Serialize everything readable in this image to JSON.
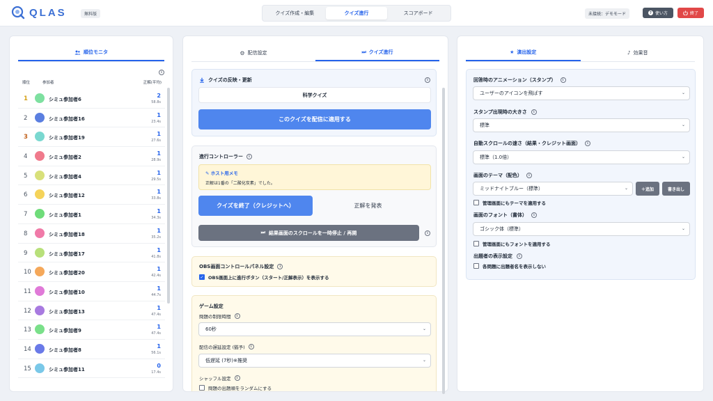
{
  "header": {
    "logo_text": "QLAS",
    "plan_badge": "無料版",
    "tabs": [
      {
        "label": "クイズ作成・編集"
      },
      {
        "label": "クイズ進行"
      },
      {
        "label": "スコアボード"
      }
    ],
    "connection": "未接続：デモモード",
    "help_label": "使い方",
    "end_label": "終了"
  },
  "left": {
    "tab_label": "順位モニタ",
    "col_rank": "順位",
    "col_name": "参加者",
    "col_score": "正解(平均)",
    "rows": [
      {
        "rank": "1",
        "name": "シミュ参加者6",
        "correct": "2",
        "time": "58.8s",
        "color": "#7ee0a0"
      },
      {
        "rank": "2",
        "name": "シミュ参加者16",
        "correct": "1",
        "time": "23.4s",
        "color": "#5b7fe0"
      },
      {
        "rank": "3",
        "name": "シミュ参加者19",
        "correct": "1",
        "time": "27.6s",
        "color": "#7ad8d0"
      },
      {
        "rank": "4",
        "name": "シミュ参加者2",
        "correct": "1",
        "time": "28.9s",
        "color": "#f07a8c"
      },
      {
        "rank": "5",
        "name": "シミュ参加者4",
        "correct": "1",
        "time": "29.5s",
        "color": "#d8e07a"
      },
      {
        "rank": "6",
        "name": "シミュ参加者12",
        "correct": "1",
        "time": "33.8s",
        "color": "#f5d35a"
      },
      {
        "rank": "7",
        "name": "シミュ参加者1",
        "correct": "1",
        "time": "34.3s",
        "color": "#6fdc7a"
      },
      {
        "rank": "8",
        "name": "シミュ参加者18",
        "correct": "1",
        "time": "35.2s",
        "color": "#f07aa8"
      },
      {
        "rank": "9",
        "name": "シミュ参加者17",
        "correct": "1",
        "time": "41.8s",
        "color": "#b8e07a"
      },
      {
        "rank": "10",
        "name": "シミュ参加者20",
        "correct": "1",
        "time": "42.4s",
        "color": "#f5a85a"
      },
      {
        "rank": "11",
        "name": "シミュ参加者10",
        "correct": "1",
        "time": "44.7s",
        "color": "#e07ad8"
      },
      {
        "rank": "12",
        "name": "シミュ参加者13",
        "correct": "1",
        "time": "47.4s",
        "color": "#a87ae0"
      },
      {
        "rank": "13",
        "name": "シミュ参加者9",
        "correct": "1",
        "time": "47.4s",
        "color": "#7ae08a"
      },
      {
        "rank": "14",
        "name": "シミュ参加者8",
        "correct": "1",
        "time": "56.1s",
        "color": "#6a7ae8"
      },
      {
        "rank": "15",
        "name": "シミュ参加者11",
        "correct": "0",
        "time": "17.4s",
        "color": "#7ac8e8"
      }
    ]
  },
  "mid": {
    "tab_broadcast": "配信設定",
    "tab_progress": "クイズ進行",
    "quiz_update_title": "クイズの反映・更新",
    "quiz_name": "科学クイズ",
    "apply_button": "このクイズを配信に適用する",
    "controller_title": "進行コントローラー",
    "memo_title": "ホスト用メモ",
    "memo_body": "正解は1番の「二酸化炭素」でした。",
    "end_quiz_button": "クイズを終了（クレジットへ）",
    "reveal_button": "正解を発表",
    "pause_scroll_button": "結果画面のスクロールを一時停止 / 再開",
    "obs_title": "OBS画面コントロールパネル設定",
    "obs_check_label": "OBS画面上に進行ボタン（スタート/正解表示）を表示する",
    "game_title": "ゲーム設定",
    "time_limit_label": "問題の制限時間",
    "time_limit_value": "60秒",
    "delay_label": "配信の遅延設定 (猶予)",
    "delay_value": "低遅延 (7秒)※推奨",
    "shuffle_label": "シャッフル設定",
    "shuffle_check_label": "問題の出題順をランダムにする"
  },
  "right": {
    "tab_effects": "演出設定",
    "tab_sound": "効果音",
    "anim_label": "回答時のアニメーション（スタンプ）",
    "anim_value": "ユーザーのアイコンを飛ばす",
    "stamp_size_label": "スタンプ出現時の大きさ",
    "stamp_size_value": "標準",
    "scroll_speed_label": "自動スクロールの速さ（結果・クレジット画面）",
    "scroll_speed_value": "標準（1.0倍）",
    "theme_label": "画面のテーマ（配色）",
    "theme_value": "ミッドナイトブルー（標準）",
    "add_button": "＋追加",
    "export_button": "書き出し",
    "theme_check": "管理画面にもテーマを適用する",
    "font_label": "画面のフォント（書体）",
    "font_value": "ゴシック体（標準）",
    "font_check": "管理画面にもフォントを適用する",
    "author_label": "出題者の表示設定",
    "author_check": "各問題に出題者名を表示しない"
  },
  "colors": {
    "accent": "#2563eb",
    "primary_button": "#4f86ee",
    "danger": "#e14848"
  }
}
